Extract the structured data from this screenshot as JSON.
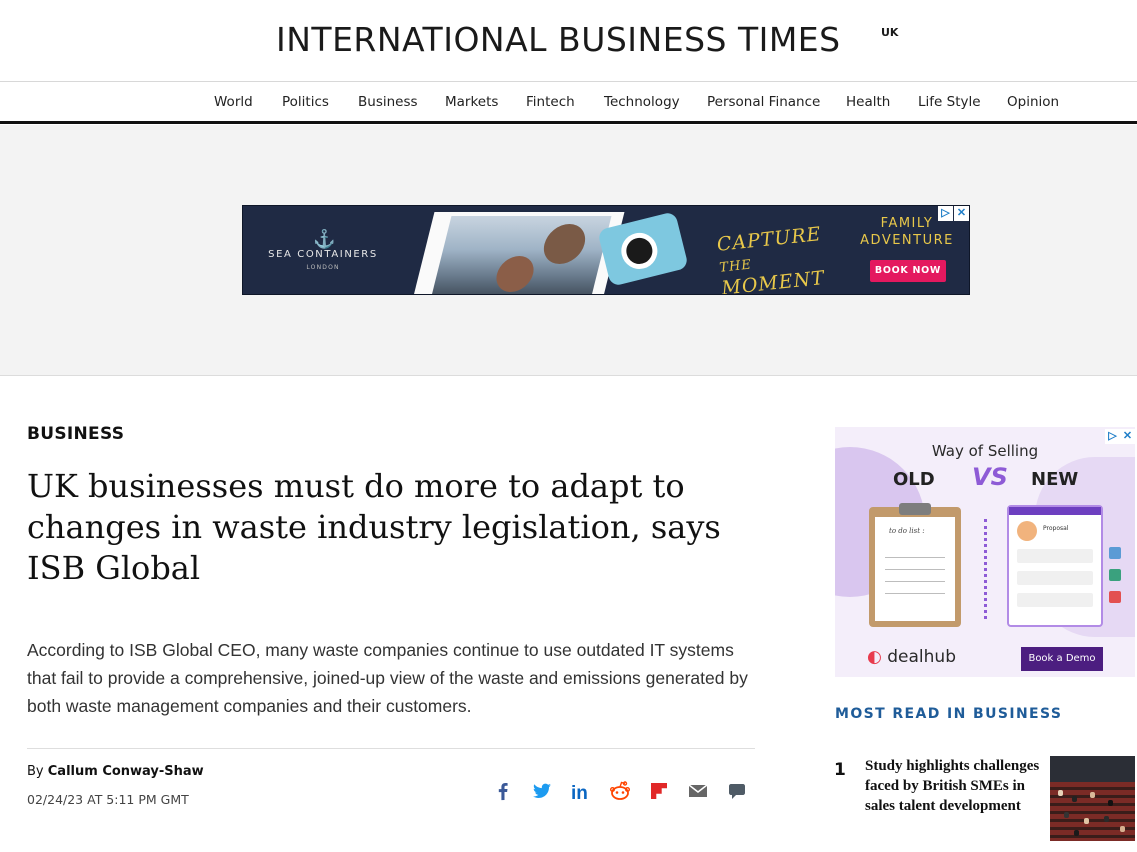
{
  "site": {
    "logo_text": "INTERNATIONAL BUSINESS TIMES",
    "logo_edition": "UK"
  },
  "nav": {
    "items": [
      {
        "label": "World"
      },
      {
        "label": "Politics"
      },
      {
        "label": "Business"
      },
      {
        "label": "Markets"
      },
      {
        "label": "Fintech"
      },
      {
        "label": "Technology"
      },
      {
        "label": "Personal Finance"
      },
      {
        "label": "Health"
      },
      {
        "label": "Life Style"
      },
      {
        "label": "Opinion"
      }
    ]
  },
  "top_ad": {
    "brand": "SEA CONTAINERS",
    "brand_sub": "LONDON",
    "headline_part1": "CAPTURE",
    "headline_part2": "THE",
    "headline_part3": "MOMENT",
    "tagline_line1": "FAMILY",
    "tagline_line2": "ADVENTURE",
    "cta": "BOOK NOW",
    "accent_color": "#e4195f",
    "bg_color": "#1f2a44",
    "adchoices_icon": "adchoices-icon",
    "close_icon": "close-icon"
  },
  "article": {
    "section": "BUSINESS",
    "headline": "UK businesses must do more to adapt to changes in waste industry legislation, says ISB Global",
    "lede": "According to ISB Global CEO, many waste companies continue to use outdated IT systems that fail to provide a comprehensive, joined-up view of the waste and emissions generated by both waste management companies and their customers.",
    "byline_prefix": "By",
    "author": "Callum Conway-Shaw",
    "timestamp": "02/24/23 AT 5:11 PM GMT"
  },
  "share": {
    "icons": [
      "facebook-icon",
      "twitter-icon",
      "linkedin-icon",
      "reddit-icon",
      "flipboard-icon",
      "email-icon",
      "comment-icon"
    ]
  },
  "rail_ad": {
    "title": "Way of Selling",
    "old_label": "OLD",
    "vs_label": "VS",
    "new_label": "NEW",
    "todo_label": "to do list :",
    "proposal_label": "Proposal",
    "logo_text": "dealhub",
    "cta": "Book a Demo",
    "accent_color": "#4c1e80"
  },
  "most_read": {
    "title": "MOST READ IN BUSINESS",
    "items": [
      {
        "rank": "1",
        "title": "Study highlights challenges faced by British SMEs in sales talent development"
      }
    ]
  }
}
